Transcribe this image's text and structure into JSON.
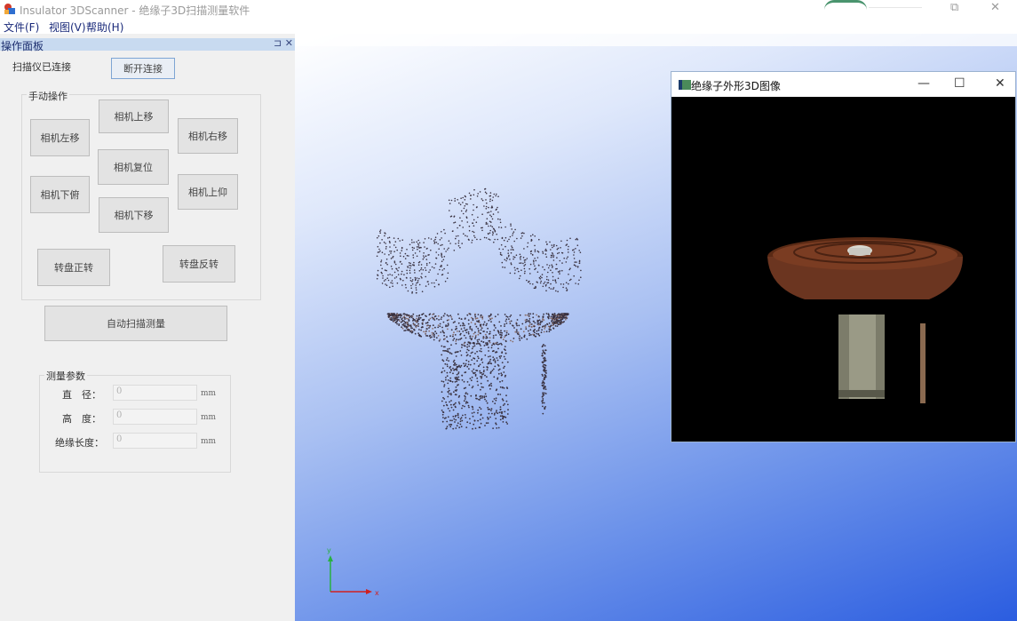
{
  "window": {
    "title": "Insulator 3DScanner - 绝缘子3D扫描测量软件",
    "restore_glyph": "⧉",
    "close_glyph": "✕"
  },
  "menu": [
    "文件(F)",
    "视图(V)",
    "帮助(H)"
  ],
  "panel": {
    "title": "操作面板",
    "pin_close": "⊐ ✕",
    "status_text": "扫描仪已连接",
    "disconnect_label": "断开连接",
    "manual_group_label": "手动操作",
    "buttons": {
      "cam_up": "相机上移",
      "cam_left": "相机左移",
      "cam_right": "相机右移",
      "cam_reset": "相机复位",
      "cam_tilt_down": "相机下俯",
      "cam_tilt_up": "相机上仰",
      "cam_down": "相机下移",
      "turntable_fwd": "转盘正转",
      "turntable_rev": "转盘反转",
      "auto_scan": "自动扫描测量"
    },
    "measure": {
      "group_label": "测量参数",
      "fields": [
        {
          "label": "直　径：",
          "value": "0",
          "unit": "mm"
        },
        {
          "label": "高　度：",
          "value": "0",
          "unit": "mm"
        },
        {
          "label": "绝缘长度：",
          "value": "0",
          "unit": "mm"
        }
      ]
    }
  },
  "child_window": {
    "title": "绝缘子外形3D图像",
    "minimize_glyph": "—",
    "maximize_glyph": "☐",
    "close_glyph": "✕"
  },
  "axes_indicator": {
    "x_label": "x",
    "y_label": "y"
  },
  "colors": {
    "panel_header": "#c8daf0",
    "view_gradient_start": "#ffffff",
    "view_gradient_end": "#2b5de0",
    "model_brown": "#6b3520"
  }
}
